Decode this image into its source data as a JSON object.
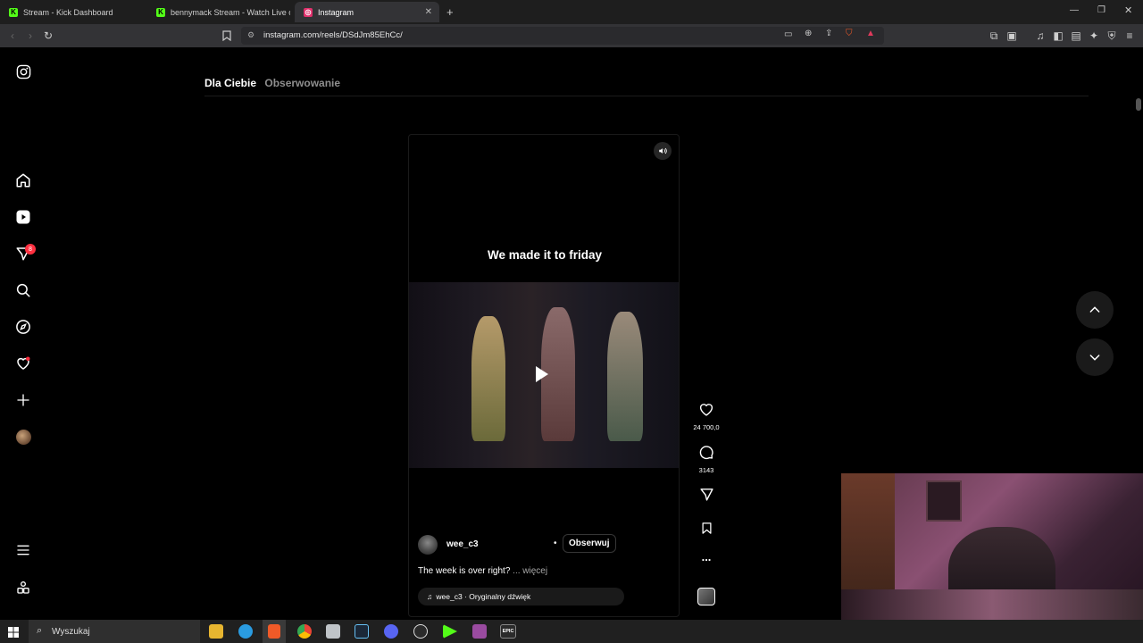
{
  "browser": {
    "tabs": [
      {
        "title": "Stream - Kick Dashboard",
        "favicon_color": "#53fc18",
        "favicon_letter": "K"
      },
      {
        "title": "bennymack Stream - Watch Live on K",
        "favicon_color": "#53fc18",
        "favicon_letter": "K"
      },
      {
        "title": "Instagram",
        "favicon_color": "#e1306c",
        "favicon_letter": "◎"
      }
    ],
    "new_tab_label": "+",
    "url": "instagram.com/reels/DSdJm85EhCc/"
  },
  "instagram": {
    "feed_tabs": {
      "active": "Dla Ciebie",
      "inactive": "Obserwowanie"
    },
    "sidebar": {
      "notifications_badge": "8"
    },
    "reel": {
      "overlay_text": "We made it to friday",
      "username": "wee_c3",
      "dot": "•",
      "follow_label": "Obserwuj",
      "description": "The week is over right?",
      "more_label": " ... więcej",
      "audio": "wee_c3 · Oryginalny dźwięk"
    },
    "actions": {
      "likes": "24 700,0",
      "comments": "3143",
      "more_label": "..."
    }
  },
  "taskbar": {
    "search_placeholder": "Wyszukaj",
    "epic_label": "EPIC"
  },
  "colors": {
    "accent": "#ff3040",
    "kick": "#53fc18",
    "background": "#000000"
  }
}
